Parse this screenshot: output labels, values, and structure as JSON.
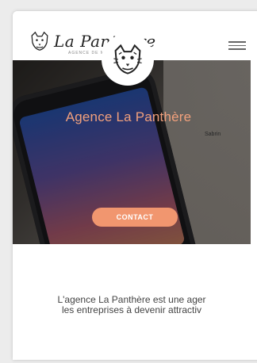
{
  "header": {
    "logo_title": "La Panthère",
    "logo_tagline": "AGENCE DE MARKETING",
    "menu_icon": "hamburger-menu-icon"
  },
  "hero": {
    "badge_icon": "panther-logo-icon",
    "background_sticker_text": "Sabrin",
    "title": "Agence La Panthère",
    "cta_label": "CONTACT"
  },
  "intro": {
    "line1": "L'agence La Panthère est une ager",
    "line2": "les entreprises à devenir attractiv"
  },
  "colors": {
    "accent": "#f1966f",
    "title_accent": "#f1a07c",
    "text": "#444444"
  }
}
